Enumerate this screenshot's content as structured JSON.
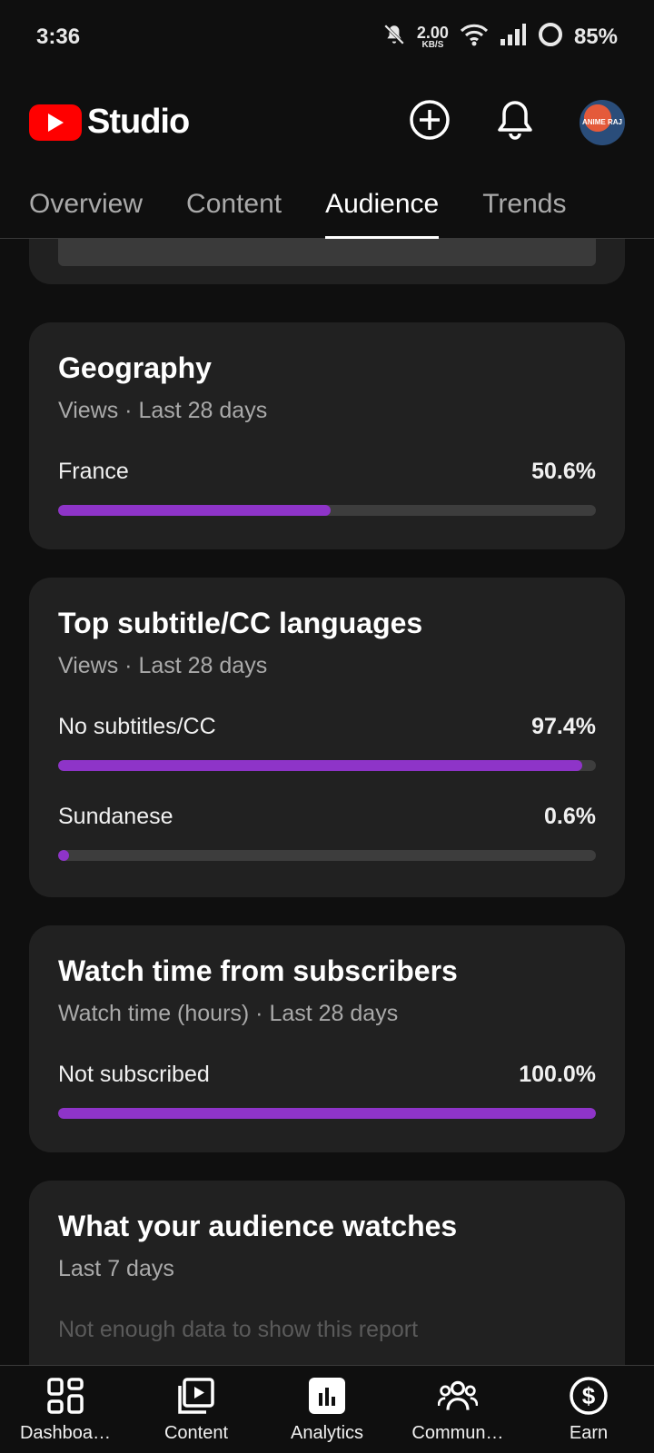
{
  "status_bar": {
    "time": "3:36",
    "net_speed_value": "2.00",
    "net_speed_unit": "KB/S",
    "battery": "85%"
  },
  "app_bar": {
    "logo_text": "Studio",
    "avatar_text": "ANIME RAJ"
  },
  "tabs": [
    {
      "label": "Overview",
      "active": false
    },
    {
      "label": "Content",
      "active": false
    },
    {
      "label": "Audience",
      "active": true
    },
    {
      "label": "Trends",
      "active": false
    }
  ],
  "cards": {
    "geography": {
      "title": "Geography",
      "subtitle": "Views · Last 28 days",
      "rows": [
        {
          "label": "France",
          "pct_text": "50.6%",
          "fraction": 0.506
        }
      ]
    },
    "subtitles": {
      "title": "Top subtitle/CC languages",
      "subtitle": "Views · Last 28 days",
      "rows": [
        {
          "label": "No subtitles/CC",
          "pct_text": "97.4%",
          "fraction": 0.974
        },
        {
          "label": "Sundanese",
          "pct_text": "0.6%",
          "fraction": 0.006
        }
      ]
    },
    "subscribers": {
      "title": "Watch time from subscribers",
      "subtitle": "Watch time (hours) · Last 28 days",
      "rows": [
        {
          "label": "Not subscribed",
          "pct_text": "100.0%",
          "fraction": 1.0
        }
      ]
    },
    "audience_watches": {
      "title": "What your audience watches",
      "subtitle": "Last 7 days",
      "note": "Not enough data to show this report"
    }
  },
  "bottom_nav": [
    {
      "label": "Dashboa…",
      "icon": "dashboard-icon"
    },
    {
      "label": "Content",
      "icon": "content-icon"
    },
    {
      "label": "Analytics",
      "icon": "analytics-icon",
      "active": true
    },
    {
      "label": "Commun…",
      "icon": "community-icon"
    },
    {
      "label": "Earn",
      "icon": "earn-icon"
    }
  ],
  "colors": {
    "accent_bar": "#8e34c8",
    "brand_red": "#ff0000"
  }
}
